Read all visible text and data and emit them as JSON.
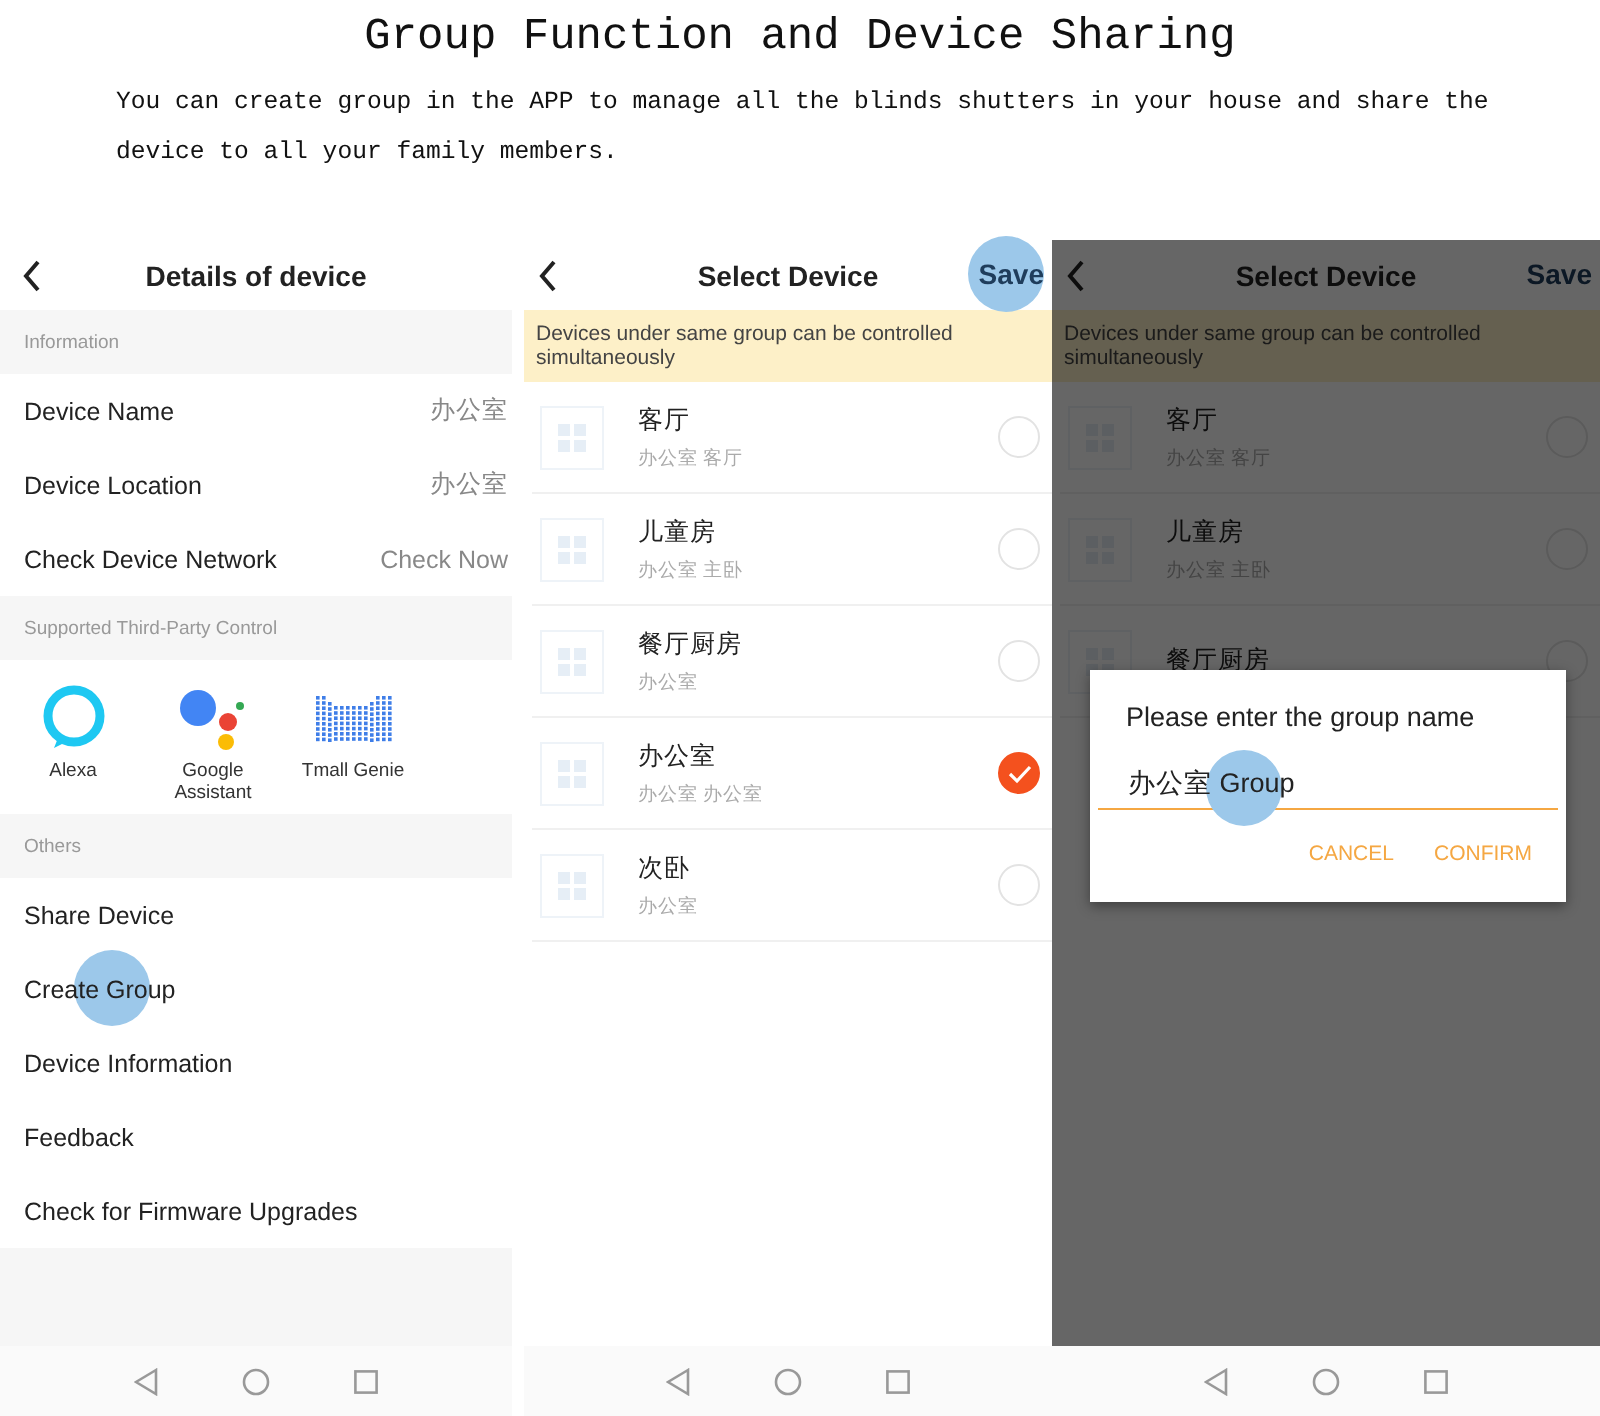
{
  "heading": {
    "title": "Group Function and Device Sharing",
    "description": "You can create group in the APP to manage all the blinds shutters in your house and share the device to all your family members."
  },
  "screens": [
    {
      "kind": "details",
      "title": "Details of device",
      "sections": [
        {
          "kind": "rows",
          "label": "Information",
          "rows": [
            {
              "label": "Device Name",
              "value": "办公室",
              "touched": false
            },
            {
              "label": "Device Location",
              "value": "办公室",
              "touched": false
            },
            {
              "label": "Check Device Network",
              "value": "Check Now",
              "touched": false
            }
          ]
        },
        {
          "kind": "services",
          "label": "Supported Third-Party Control",
          "services": [
            {
              "kind": "alexa",
              "label": "Alexa"
            },
            {
              "kind": "google",
              "label": "Google Assistant"
            },
            {
              "kind": "tmall",
              "label": "Tmall Genie"
            }
          ]
        },
        {
          "kind": "rows",
          "label": "Others",
          "rows": [
            {
              "label": "Share Device",
              "touched": false
            },
            {
              "label": "Create Group",
              "touched": true
            },
            {
              "label": "Device Information",
              "touched": false
            },
            {
              "label": "Feedback",
              "touched": false
            },
            {
              "label": "Check for Firmware Upgrades",
              "touched": false
            }
          ]
        }
      ]
    },
    {
      "kind": "select",
      "title": "Select Device",
      "action": {
        "label": "Save",
        "touched": true
      },
      "notice": "Devices under same group can be controlled simultaneously",
      "dimmed": false,
      "devices": [
        {
          "name": "客厅",
          "subtitle": "办公室 客厅",
          "selected": false
        },
        {
          "name": "儿童房",
          "subtitle": "办公室 主卧",
          "selected": false
        },
        {
          "name": "餐厅厨房",
          "subtitle": "办公室",
          "selected": false
        },
        {
          "name": "办公室",
          "subtitle": "办公室 办公室",
          "selected": true
        },
        {
          "name": "次卧",
          "subtitle": "办公室",
          "selected": false
        }
      ]
    },
    {
      "kind": "select",
      "title": "Select Device",
      "action": {
        "label": "Save",
        "touched": false
      },
      "notice": "Devices under same group can be controlled simultaneously",
      "dimmed": true,
      "devices": [
        {
          "name": "客厅",
          "subtitle": "办公室 客厅",
          "selected": false
        },
        {
          "name": "儿童房",
          "subtitle": "办公室 主卧",
          "selected": false
        },
        {
          "name": "餐厅厨房",
          "selected": false
        }
      ],
      "dialog": {
        "title": "Please enter the group name",
        "value": "办公室 Group",
        "touched": true,
        "buttons": [
          "CANCEL",
          "CONFIRM"
        ]
      }
    }
  ]
}
